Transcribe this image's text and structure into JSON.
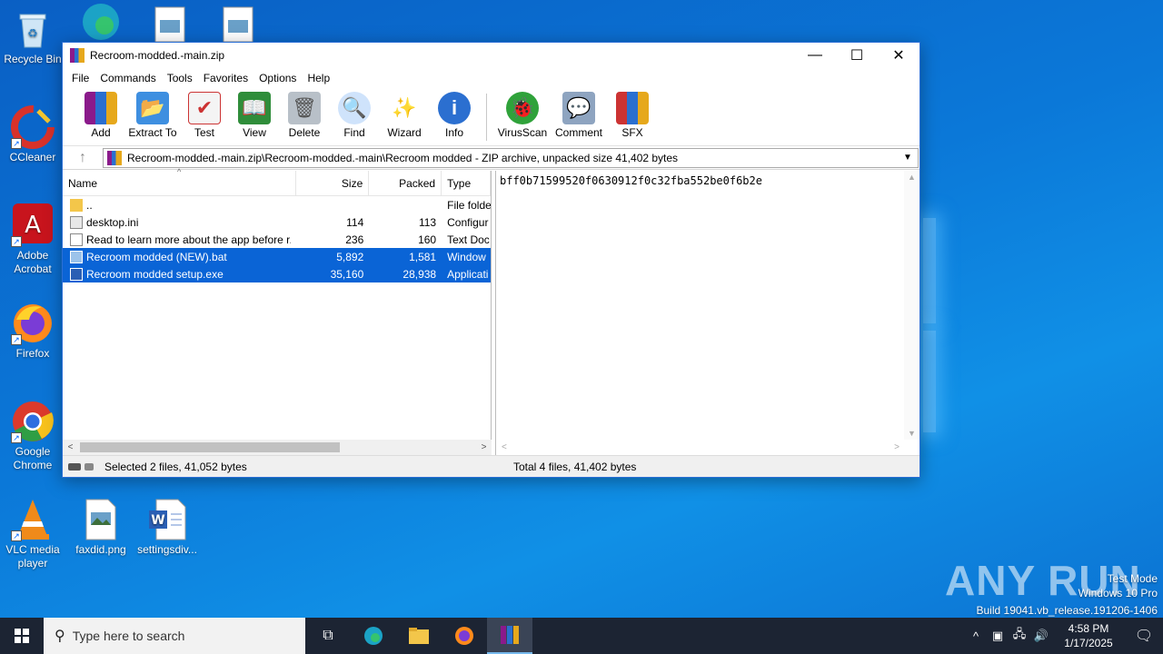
{
  "desktop": {
    "icons": [
      {
        "label": "Recycle Bin"
      },
      {
        "label": "CCleaner"
      },
      {
        "label": "Adobe Acrobat"
      },
      {
        "label": "Firefox"
      },
      {
        "label": "Google Chrome"
      },
      {
        "label": "VLC media player"
      },
      {
        "label": "faxdid.png"
      },
      {
        "label": "settingsdiv..."
      }
    ],
    "watermark": {
      "brand": "ANY RUN",
      "line1": "Test Mode",
      "line2": "Windows 10 Pro",
      "line3": "Build 19041.vb_release.191206-1406"
    }
  },
  "window": {
    "title": "Recroom-modded.-main.zip",
    "menu": [
      "File",
      "Commands",
      "Tools",
      "Favorites",
      "Options",
      "Help"
    ],
    "toolbar": [
      {
        "label": "Add",
        "icon": "add-icon"
      },
      {
        "label": "Extract To",
        "icon": "extract-icon"
      },
      {
        "label": "Test",
        "icon": "test-icon"
      },
      {
        "label": "View",
        "icon": "view-icon"
      },
      {
        "label": "Delete",
        "icon": "delete-icon"
      },
      {
        "label": "Find",
        "icon": "find-icon"
      },
      {
        "label": "Wizard",
        "icon": "wizard-icon"
      },
      {
        "label": "Info",
        "icon": "info-icon"
      },
      {
        "label": "VirusScan",
        "icon": "virusscan-icon"
      },
      {
        "label": "Comment",
        "icon": "comment-icon"
      },
      {
        "label": "SFX",
        "icon": "sfx-icon"
      }
    ],
    "path": "Recroom-modded.-main.zip\\Recroom-modded.-main\\Recroom modded - ZIP archive, unpacked size 41,402 bytes",
    "columns": {
      "name": "Name",
      "size": "Size",
      "packed": "Packed",
      "type": "Type"
    },
    "files": [
      {
        "name": "..",
        "size": "",
        "packed": "",
        "type": "File folde",
        "selected": false
      },
      {
        "name": "desktop.ini",
        "size": "114",
        "packed": "113",
        "type": "Configur",
        "selected": false
      },
      {
        "name": "Read to learn more about the app before r...",
        "size": "236",
        "packed": "160",
        "type": "Text Doc",
        "selected": false
      },
      {
        "name": "Recroom modded (NEW).bat",
        "size": "5,892",
        "packed": "1,581",
        "type": "Window",
        "selected": true
      },
      {
        "name": "Recroom modded setup.exe",
        "size": "35,160",
        "packed": "28,938",
        "type": "Applicati",
        "selected": true
      }
    ],
    "comment": "bff0b71599520f0630912f0c32fba552be0f6b2e",
    "status_left": "Selected 2 files, 41,052 bytes",
    "status_right": "Total 4 files, 41,402 bytes"
  },
  "taskbar": {
    "search_placeholder": "Type here to search",
    "time": "4:58 PM",
    "date": "1/17/2025"
  }
}
